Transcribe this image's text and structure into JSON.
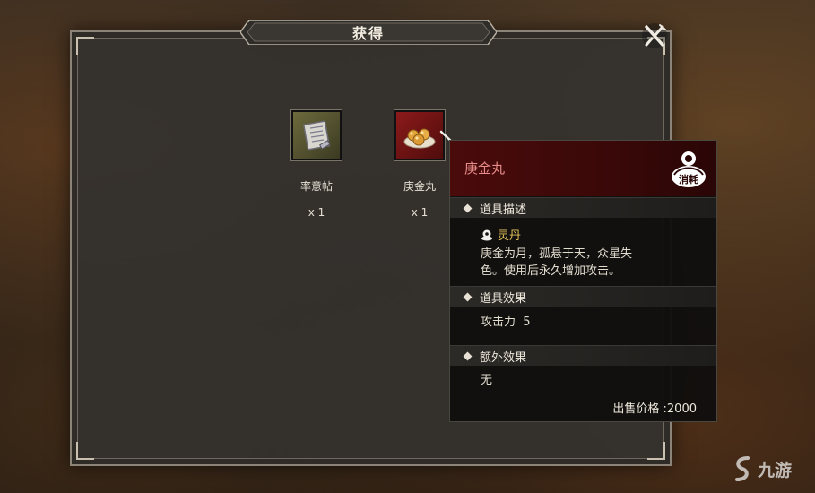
{
  "dialog": {
    "title": "获得"
  },
  "items": [
    {
      "name": "率意帖",
      "qty": "x 1",
      "icon": "scroll-icon"
    },
    {
      "name": "庚金丸",
      "qty": "x 1",
      "icon": "pill-icon"
    }
  ],
  "tooltip": {
    "name": "庚金丸",
    "badge_text": "消耗",
    "sections": {
      "desc_title": "道具描述",
      "category": "灵丹",
      "desc_line1": "庚金为月，孤悬于天，众星失",
      "desc_line2": "色。使用后永久增加攻击。",
      "effect_title": "道具效果",
      "effect_text": "攻击力  5",
      "extra_title": "额外效果",
      "extra_text": "无"
    },
    "price": "出售价格 :2000"
  },
  "watermark": {
    "text": "九游"
  },
  "colors": {
    "item_name_red": "#e78c88",
    "category_gold": "#e2c15a",
    "header_red": "#4a0b0b"
  }
}
